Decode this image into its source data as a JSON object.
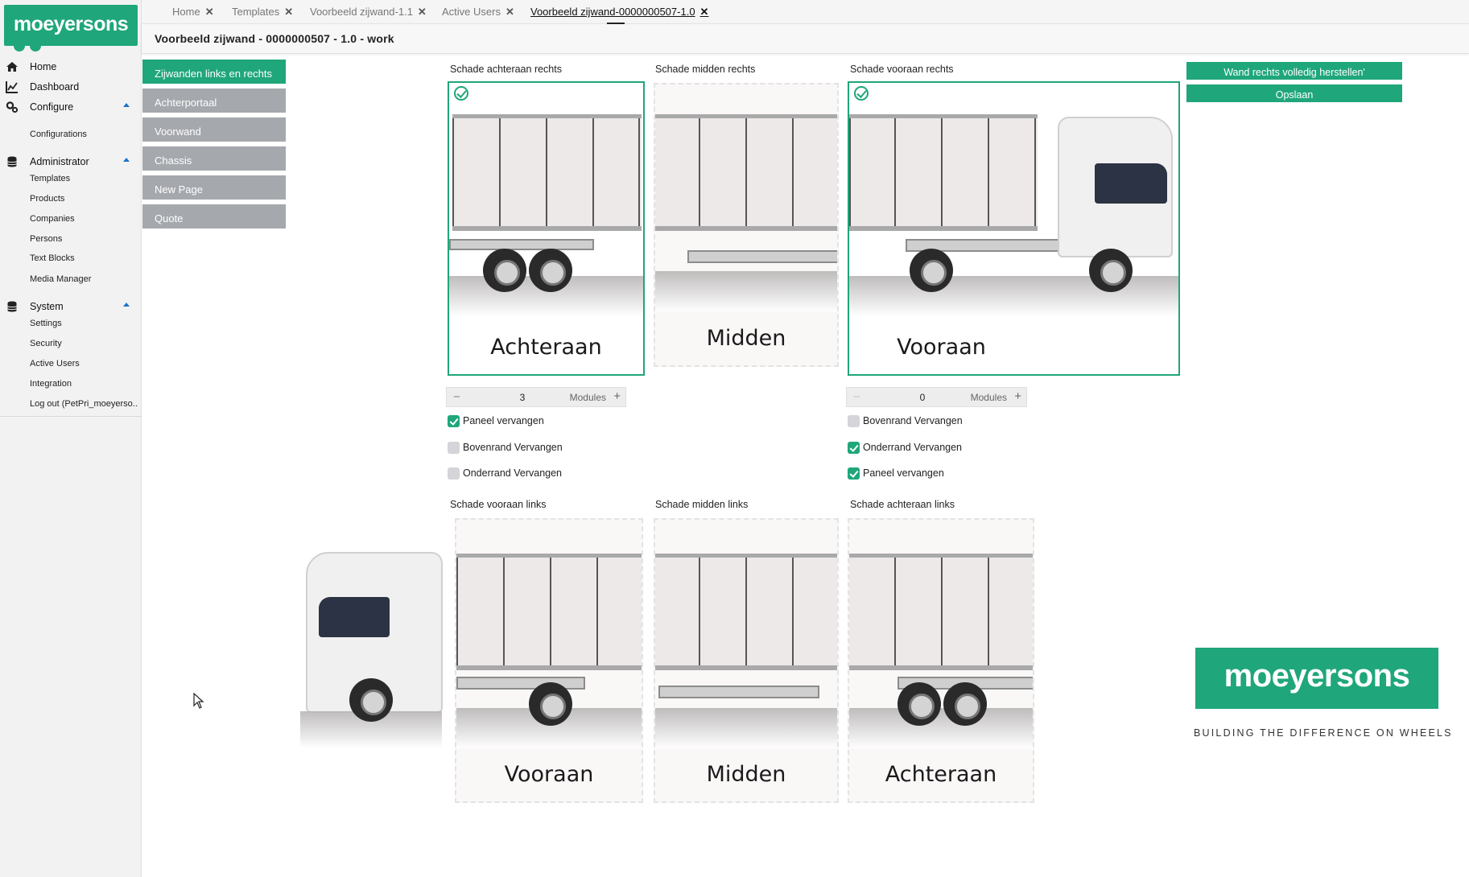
{
  "brand": {
    "name": "moeyersons",
    "tagline": "BUILDING THE DIFFERENCE ON WHEELS"
  },
  "sidebar": {
    "sections": [
      {
        "label": "Home",
        "icon": "home-icon"
      },
      {
        "label": "Dashboard",
        "icon": "dashboard-icon"
      },
      {
        "label": "Configure",
        "icon": "cogs-icon",
        "expanded": true,
        "items": [
          "Configurations"
        ]
      },
      {
        "label": "Administrator",
        "icon": "database-icon",
        "expanded": true,
        "items": [
          "Templates",
          "Products",
          "Companies",
          "Persons",
          "Text Blocks",
          "Media Manager"
        ]
      },
      {
        "label": "System",
        "icon": "database-icon",
        "expanded": true,
        "items": [
          "Settings",
          "Security",
          "Active Users",
          "Integration",
          "Log out (PetPri_moeyerso..."
        ]
      }
    ]
  },
  "tabs": [
    {
      "label": "Home",
      "active": false
    },
    {
      "label": "Templates",
      "active": false
    },
    {
      "label": "Voorbeeld zijwand-1.1",
      "active": false
    },
    {
      "label": "Active Users",
      "active": false
    },
    {
      "label": "Voorbeeld zijwand-0000000507-1.0",
      "active": true
    }
  ],
  "page": {
    "title": "Voorbeeld zijwand - 0000000507 - 1.0 - work"
  },
  "section_nav": [
    {
      "label": "Zijwanden links en rechts",
      "active": true
    },
    {
      "label": "Achterportaal",
      "active": false
    },
    {
      "label": "Voorwand",
      "active": false
    },
    {
      "label": "Chassis",
      "active": false
    },
    {
      "label": "New Page",
      "active": false
    },
    {
      "label": "Quote",
      "active": false
    }
  ],
  "right_panels": [
    {
      "label": "Schade achteraan rechts",
      "big_label": "Achteraan",
      "selected": true
    },
    {
      "label": "Schade midden rechts",
      "big_label": "Midden",
      "selected": false
    },
    {
      "label": "Schade vooraan rechts",
      "big_label": "Vooraan",
      "selected": true
    }
  ],
  "left_panels": [
    {
      "label": "Schade vooraan links",
      "big_label": "Vooraan"
    },
    {
      "label": "Schade midden links",
      "big_label": "Midden"
    },
    {
      "label": "Schade achteraan links",
      "big_label": "Achteraan"
    }
  ],
  "stepper_rear": {
    "value": "3",
    "unit": "Modules",
    "minus": "−",
    "plus": "+"
  },
  "stepper_front": {
    "value": "0",
    "unit": "Modules",
    "minus": "−",
    "plus": "+"
  },
  "options_rear": [
    {
      "label": "Paneel vervangen",
      "checked": true
    },
    {
      "label": "Bovenrand Vervangen",
      "checked": false
    },
    {
      "label": "Onderrand Vervangen",
      "checked": false
    }
  ],
  "options_front": [
    {
      "label": "Bovenrand Vervangen",
      "checked": false
    },
    {
      "label": "Onderrand Vervangen",
      "checked": true
    },
    {
      "label": "Paneel vervangen",
      "checked": true
    }
  ],
  "actions": {
    "restore_label": "Wand rechts volledig herstellen'",
    "save_label": "Opslaan"
  },
  "colors": {
    "accent": "#1fa67a",
    "nav_inactive": "#a5a8ad",
    "caret": "#1a73c8"
  }
}
